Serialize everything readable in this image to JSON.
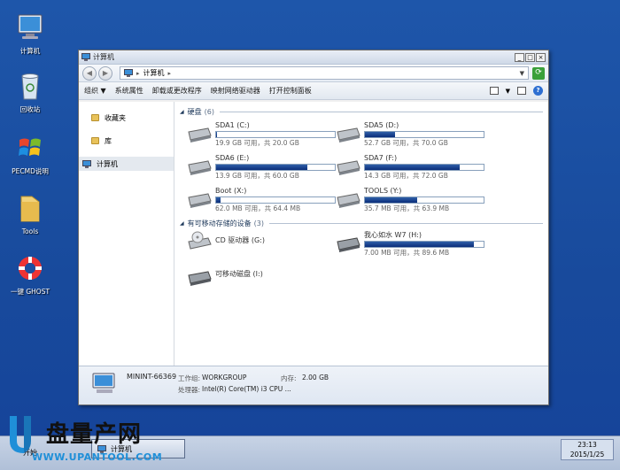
{
  "desktop": {
    "icons": [
      {
        "label": "计算机",
        "icon": "computer-icon"
      },
      {
        "label": "回收站",
        "icon": "recycle-bin-icon"
      },
      {
        "label": "PECMD说明",
        "icon": "windows-logo-icon"
      },
      {
        "label": "Tools",
        "icon": "folder-icon"
      },
      {
        "label": "一键 GHOST",
        "icon": "ghost-lifebuoy-icon"
      }
    ]
  },
  "window": {
    "title": "计算机",
    "address": {
      "crumb": "计算机"
    },
    "commands": {
      "organize": "组织 ▼",
      "system_properties": "系统属性",
      "uninstall": "卸载或更改程序",
      "map_drive": "映射网络驱动器",
      "control_panel": "打开控制面板"
    },
    "nav": {
      "favorites": "收藏夹",
      "libraries": "库",
      "computer": "计算机"
    },
    "groups": {
      "hard_disks": {
        "title": "硬盘",
        "count": "(6)"
      },
      "removable": {
        "title": "有可移动存储的设备",
        "count": "(3)"
      }
    },
    "drives": [
      {
        "name": "SDA1 (C:)",
        "size": "19.9 GB 可用，共 20.0 GB",
        "used": 0.005
      },
      {
        "name": "SDA5 (D:)",
        "size": "52.7 GB 可用，共 70.0 GB",
        "used": 0.25
      },
      {
        "name": "SDA6 (E:)",
        "size": "13.9 GB 可用，共 60.0 GB",
        "used": 0.77
      },
      {
        "name": "SDA7 (F:)",
        "size": "14.3 GB 可用，共 72.0 GB",
        "used": 0.8
      },
      {
        "name": "Boot (X:)",
        "size": "62.0 MB 可用，共 64.4 MB",
        "used": 0.04
      },
      {
        "name": "TOOLS (Y:)",
        "size": "35.7 MB 可用，共 63.9 MB",
        "used": 0.44
      }
    ],
    "removable_drives": [
      {
        "name": "CD 驱动器 (G:)"
      },
      {
        "name": "我心如水 W7 (H:)",
        "size": "7.00 MB 可用，共 89.6 MB",
        "used": 0.92
      },
      {
        "name": "可移动磁盘 (I:)"
      }
    ],
    "details": {
      "pc_name": "MININT-66369",
      "workgroup_label": "工作组:",
      "workgroup": "WORKGROUP",
      "memory_label": "内存:",
      "memory": "2.00 GB",
      "cpu_label": "处理器:",
      "cpu": "Intel(R) Core(TM) i3 CPU ..."
    }
  },
  "taskbar": {
    "start_label": "开始",
    "task_label": "计算机",
    "time": "23:13",
    "date": "2015/1/25"
  },
  "watermark": {
    "big": "盘量产网",
    "small": "WWW.UPANTOOL.COM"
  },
  "colors": {
    "desktop": "#1c4fa0",
    "bar_fill": "#0b2e7a"
  }
}
